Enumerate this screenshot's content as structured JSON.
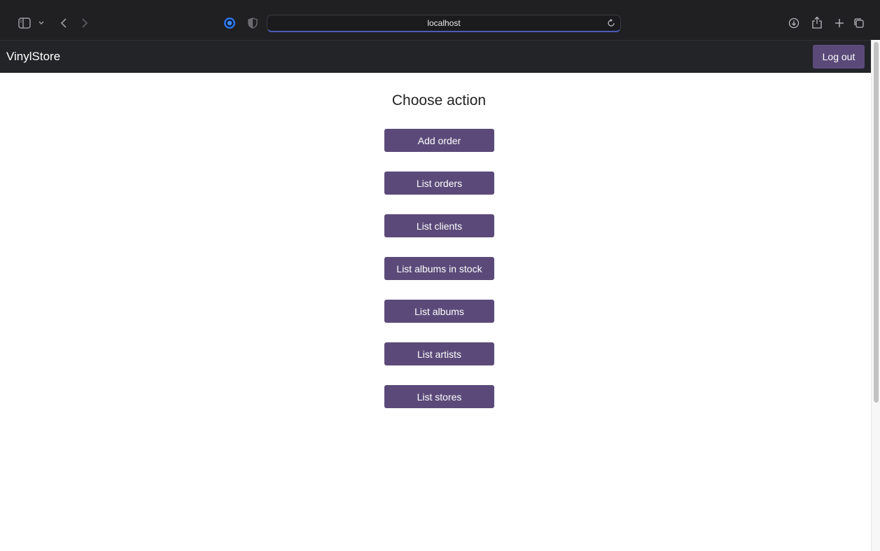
{
  "browser": {
    "url": "localhost",
    "icons": [
      "sidebar-icon",
      "chevron-down-icon",
      "back-arrow-icon",
      "forward-arrow-icon",
      "privacy-report-icon",
      "shield-icon",
      "reload-icon",
      "download-icon",
      "share-icon",
      "plus-icon",
      "tabs-icon"
    ]
  },
  "navbar": {
    "brand": "VinylStore",
    "logout_label": "Log out"
  },
  "main": {
    "title": "Choose action",
    "actions": [
      {
        "label": "Add order"
      },
      {
        "label": "List orders"
      },
      {
        "label": "List clients"
      },
      {
        "label": "List albums in stock"
      },
      {
        "label": "List albums"
      },
      {
        "label": "List artists"
      },
      {
        "label": "List stores"
      }
    ]
  },
  "colors": {
    "accent": "#5b4a79",
    "navbar_bg": "#222427",
    "chrome_bg": "#201f22"
  }
}
